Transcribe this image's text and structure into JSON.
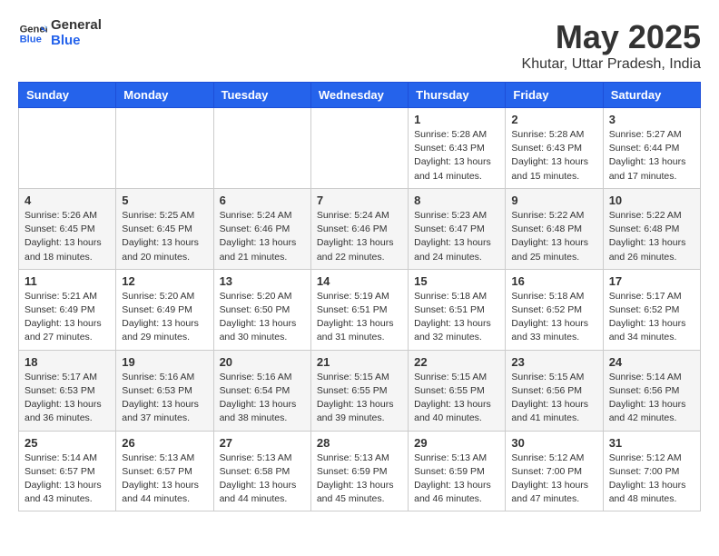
{
  "logo": {
    "line1": "General",
    "line2": "Blue"
  },
  "title": "May 2025",
  "location": "Khutar, Uttar Pradesh, India",
  "days_of_week": [
    "Sunday",
    "Monday",
    "Tuesday",
    "Wednesday",
    "Thursday",
    "Friday",
    "Saturday"
  ],
  "weeks": [
    [
      {
        "num": "",
        "info": ""
      },
      {
        "num": "",
        "info": ""
      },
      {
        "num": "",
        "info": ""
      },
      {
        "num": "",
        "info": ""
      },
      {
        "num": "1",
        "info": "Sunrise: 5:28 AM\nSunset: 6:43 PM\nDaylight: 13 hours\nand 14 minutes."
      },
      {
        "num": "2",
        "info": "Sunrise: 5:28 AM\nSunset: 6:43 PM\nDaylight: 13 hours\nand 15 minutes."
      },
      {
        "num": "3",
        "info": "Sunrise: 5:27 AM\nSunset: 6:44 PM\nDaylight: 13 hours\nand 17 minutes."
      }
    ],
    [
      {
        "num": "4",
        "info": "Sunrise: 5:26 AM\nSunset: 6:45 PM\nDaylight: 13 hours\nand 18 minutes."
      },
      {
        "num": "5",
        "info": "Sunrise: 5:25 AM\nSunset: 6:45 PM\nDaylight: 13 hours\nand 20 minutes."
      },
      {
        "num": "6",
        "info": "Sunrise: 5:24 AM\nSunset: 6:46 PM\nDaylight: 13 hours\nand 21 minutes."
      },
      {
        "num": "7",
        "info": "Sunrise: 5:24 AM\nSunset: 6:46 PM\nDaylight: 13 hours\nand 22 minutes."
      },
      {
        "num": "8",
        "info": "Sunrise: 5:23 AM\nSunset: 6:47 PM\nDaylight: 13 hours\nand 24 minutes."
      },
      {
        "num": "9",
        "info": "Sunrise: 5:22 AM\nSunset: 6:48 PM\nDaylight: 13 hours\nand 25 minutes."
      },
      {
        "num": "10",
        "info": "Sunrise: 5:22 AM\nSunset: 6:48 PM\nDaylight: 13 hours\nand 26 minutes."
      }
    ],
    [
      {
        "num": "11",
        "info": "Sunrise: 5:21 AM\nSunset: 6:49 PM\nDaylight: 13 hours\nand 27 minutes."
      },
      {
        "num": "12",
        "info": "Sunrise: 5:20 AM\nSunset: 6:49 PM\nDaylight: 13 hours\nand 29 minutes."
      },
      {
        "num": "13",
        "info": "Sunrise: 5:20 AM\nSunset: 6:50 PM\nDaylight: 13 hours\nand 30 minutes."
      },
      {
        "num": "14",
        "info": "Sunrise: 5:19 AM\nSunset: 6:51 PM\nDaylight: 13 hours\nand 31 minutes."
      },
      {
        "num": "15",
        "info": "Sunrise: 5:18 AM\nSunset: 6:51 PM\nDaylight: 13 hours\nand 32 minutes."
      },
      {
        "num": "16",
        "info": "Sunrise: 5:18 AM\nSunset: 6:52 PM\nDaylight: 13 hours\nand 33 minutes."
      },
      {
        "num": "17",
        "info": "Sunrise: 5:17 AM\nSunset: 6:52 PM\nDaylight: 13 hours\nand 34 minutes."
      }
    ],
    [
      {
        "num": "18",
        "info": "Sunrise: 5:17 AM\nSunset: 6:53 PM\nDaylight: 13 hours\nand 36 minutes."
      },
      {
        "num": "19",
        "info": "Sunrise: 5:16 AM\nSunset: 6:53 PM\nDaylight: 13 hours\nand 37 minutes."
      },
      {
        "num": "20",
        "info": "Sunrise: 5:16 AM\nSunset: 6:54 PM\nDaylight: 13 hours\nand 38 minutes."
      },
      {
        "num": "21",
        "info": "Sunrise: 5:15 AM\nSunset: 6:55 PM\nDaylight: 13 hours\nand 39 minutes."
      },
      {
        "num": "22",
        "info": "Sunrise: 5:15 AM\nSunset: 6:55 PM\nDaylight: 13 hours\nand 40 minutes."
      },
      {
        "num": "23",
        "info": "Sunrise: 5:15 AM\nSunset: 6:56 PM\nDaylight: 13 hours\nand 41 minutes."
      },
      {
        "num": "24",
        "info": "Sunrise: 5:14 AM\nSunset: 6:56 PM\nDaylight: 13 hours\nand 42 minutes."
      }
    ],
    [
      {
        "num": "25",
        "info": "Sunrise: 5:14 AM\nSunset: 6:57 PM\nDaylight: 13 hours\nand 43 minutes."
      },
      {
        "num": "26",
        "info": "Sunrise: 5:13 AM\nSunset: 6:57 PM\nDaylight: 13 hours\nand 44 minutes."
      },
      {
        "num": "27",
        "info": "Sunrise: 5:13 AM\nSunset: 6:58 PM\nDaylight: 13 hours\nand 44 minutes."
      },
      {
        "num": "28",
        "info": "Sunrise: 5:13 AM\nSunset: 6:59 PM\nDaylight: 13 hours\nand 45 minutes."
      },
      {
        "num": "29",
        "info": "Sunrise: 5:13 AM\nSunset: 6:59 PM\nDaylight: 13 hours\nand 46 minutes."
      },
      {
        "num": "30",
        "info": "Sunrise: 5:12 AM\nSunset: 7:00 PM\nDaylight: 13 hours\nand 47 minutes."
      },
      {
        "num": "31",
        "info": "Sunrise: 5:12 AM\nSunset: 7:00 PM\nDaylight: 13 hours\nand 48 minutes."
      }
    ]
  ]
}
